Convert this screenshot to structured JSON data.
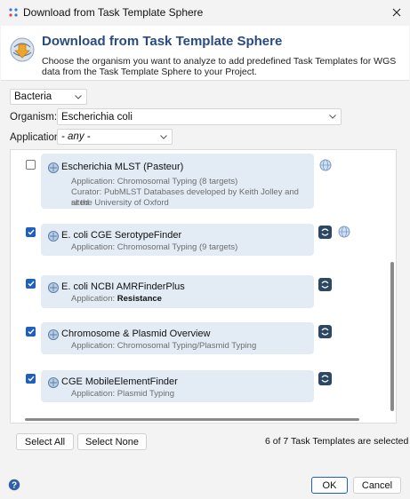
{
  "window": {
    "title": "Download from Task Template Sphere",
    "close_icon": "close-icon",
    "app_icon": "app-dots-icon"
  },
  "header": {
    "title": "Download from Task Template Sphere",
    "description": "Choose the organism you want to analyze to add predefined Task Templates for WGS data from the Task Template Sphere to your Project.",
    "icon": "download-sphere-icon"
  },
  "filters": {
    "category": {
      "value": "Bacteria"
    },
    "organism": {
      "label": "Organism:",
      "value": "Escherichia coli"
    },
    "application": {
      "label": "Application:",
      "value": "- any -"
    }
  },
  "templates": [
    {
      "title": "Escherichia MLST (Pasteur)",
      "line1": "Application: Chromosomal Typing (8 targets)",
      "line2": "Curator: PubMLST Databases developed by Keith Jolley and sited",
      "line3": "at the University of Oxford",
      "checked": false,
      "downloaded": false,
      "online": true
    },
    {
      "title": "E. coli CGE SerotypeFinder",
      "line1": "Application: Chromosomal Typing (9 targets)",
      "checked": true,
      "downloaded": true,
      "online": true
    },
    {
      "title": "E. coli NCBI AMRFinderPlus",
      "line1_prefix": "Application: ",
      "line1_bold": "Resistance",
      "checked": true,
      "downloaded": true,
      "online": false
    },
    {
      "title": "Chromosome & Plasmid Overview",
      "line1": "Application: Chromosomal Typing/Plasmid Typing",
      "checked": true,
      "downloaded": true,
      "online": false
    },
    {
      "title": "CGE MobileElementFinder",
      "line1": "Application: Plasmid Typing",
      "checked": true,
      "downloaded": true,
      "online": false
    }
  ],
  "footer": {
    "select_all": "Select All",
    "select_none": "Select None",
    "status": "6 of 7 Task Templates are selected",
    "ok": "OK",
    "cancel": "Cancel",
    "help_icon": "help-icon"
  },
  "colors": {
    "title_accent": "#2a4a82",
    "card_bg": "#e3ecf5",
    "checkbox_checked": "#1f5fbf",
    "badge_bg": "#2d4764"
  }
}
